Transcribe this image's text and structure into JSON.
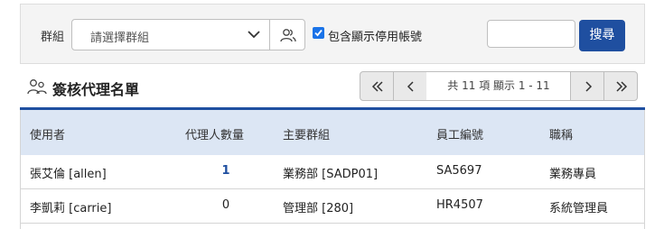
{
  "filter": {
    "group_label": "群組",
    "group_placeholder": "請選擇群組",
    "include_disabled_label": "包含顯示停用帳號",
    "include_disabled_checked": true,
    "search_value": "",
    "search_button": "搜尋"
  },
  "section": {
    "title": "簽核代理名單"
  },
  "pager": {
    "info": "共 11 項 顯示 1 - 11"
  },
  "table": {
    "headers": {
      "user": "使用者",
      "agent_count": "代理人數量",
      "main_group": "主要群組",
      "employee_id": "員工編號",
      "job_title": "職稱"
    },
    "rows": [
      {
        "user": "張艾倫 [allen]",
        "agent_count": "1",
        "main_group": "業務部 [SADP01]",
        "employee_id": "SA5697",
        "job_title": "業務專員"
      },
      {
        "user": "李凱莉 [carrie]",
        "agent_count": "0",
        "main_group": "管理部 [280]",
        "employee_id": "HR4507",
        "job_title": "系統管理員"
      }
    ]
  },
  "icons": {
    "group_picker": "users-icon",
    "section": "users-icon",
    "select_arrow": "chevron-down-icon",
    "first": "double-chevron-left-icon",
    "prev": "chevron-left-icon",
    "next": "chevron-right-icon",
    "last": "double-chevron-right-icon"
  },
  "colors": {
    "primary": "#1f4fa0",
    "header_bg": "#dce6f4",
    "checkbox": "#1a73e8"
  }
}
